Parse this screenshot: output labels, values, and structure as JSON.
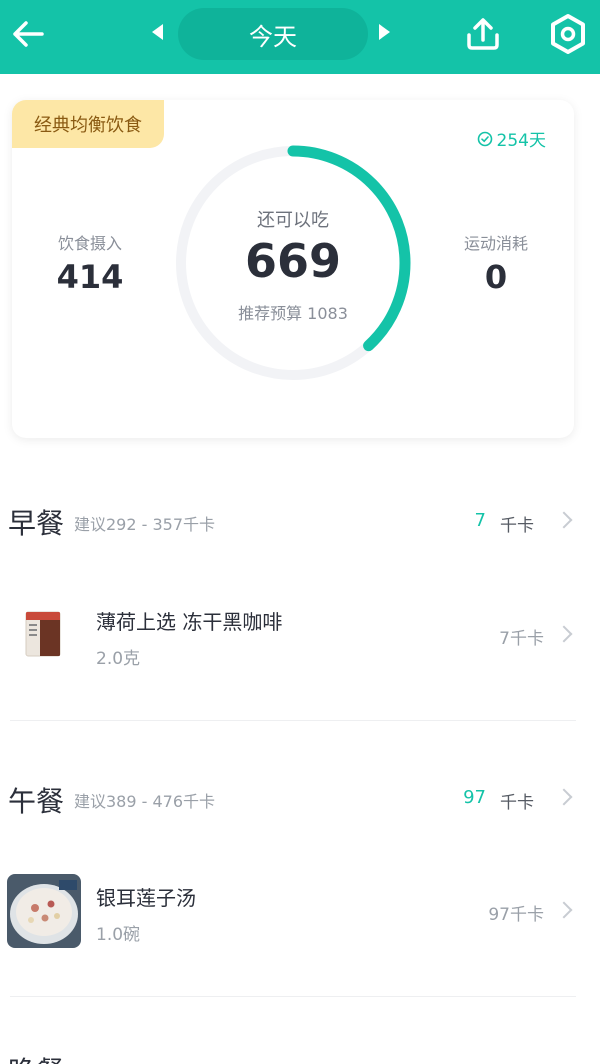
{
  "header": {
    "date_label": "今天",
    "back_icon": "arrow-left-icon",
    "prev_icon": "triangle-left-icon",
    "next_icon": "triangle-right-icon",
    "share_icon": "share-upload-icon",
    "settings_icon": "hexagon-settings-icon",
    "color": "#14c3a8"
  },
  "summary": {
    "diet_plan": "经典均衡饮食",
    "days": "254天",
    "intake_label": "饮食摄入",
    "intake_value": "414",
    "remaining_label": "还可以吃",
    "remaining_value": "669",
    "budget_text": "推荐预算 1083",
    "exercise_label": "运动消耗",
    "exercise_value": "0",
    "ring_progress": 0.382,
    "ring_color": "#14c3a8"
  },
  "meals": [
    {
      "title": "早餐",
      "suggestion": "建议292 - 357千卡",
      "kcal": "7",
      "unit": "千卡",
      "items": [
        {
          "name": "薄荷上选 冻干黑咖啡",
          "amount": "2.0克",
          "kcal": "7千卡",
          "thumb_icon": "coffee-package-icon"
        }
      ]
    },
    {
      "title": "午餐",
      "suggestion": "建议389 - 476千卡",
      "kcal": "97",
      "unit": "千卡",
      "items": [
        {
          "name": "银耳莲子汤",
          "amount": "1.0碗",
          "kcal": "97千卡",
          "thumb_icon": "soup-bowl-icon"
        }
      ]
    },
    {
      "title": "晚餐"
    }
  ]
}
